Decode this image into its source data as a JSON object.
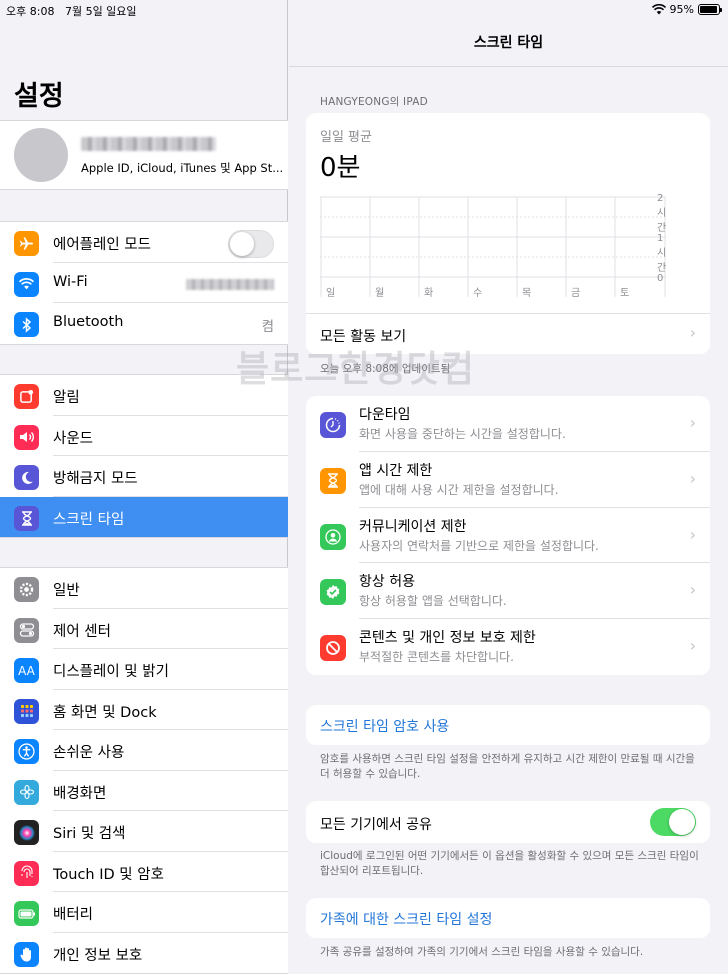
{
  "status": {
    "time": "오후 8:08",
    "date": "7월 5일 일요일",
    "battery": "95%",
    "battery_level": 0.95
  },
  "sidebar": {
    "title": "설정",
    "account_sub": "Apple ID, iCloud, iTunes 및 App St...",
    "group1": [
      {
        "label": "에어플레인 모드",
        "icon": "airplane-icon",
        "color": "#ff9500"
      },
      {
        "label": "Wi-Fi",
        "icon": "wifi-icon",
        "color": "#0a84ff"
      },
      {
        "label": "Bluetooth",
        "icon": "bluetooth-icon",
        "color": "#0a84ff",
        "value": "켬"
      }
    ],
    "group2": [
      {
        "label": "알림",
        "icon": "notifications-icon",
        "color": "#ff3b30"
      },
      {
        "label": "사운드",
        "icon": "sound-icon",
        "color": "#ff2d55"
      },
      {
        "label": "방해금지 모드",
        "icon": "moon-icon",
        "color": "#5856d6"
      },
      {
        "label": "스크린 타임",
        "icon": "hourglass-icon",
        "color": "#5856d6",
        "selected": true
      }
    ],
    "group3": [
      {
        "label": "일반",
        "icon": "gear-icon",
        "color": "#8e8e93"
      },
      {
        "label": "제어 센터",
        "icon": "toggles-icon",
        "color": "#8e8e93"
      },
      {
        "label": "디스플레이 및 밝기",
        "icon": "display-icon",
        "color": "#0a84ff"
      },
      {
        "label": "홈 화면 및 Dock",
        "icon": "home-grid-icon",
        "color": "#2f53d8"
      },
      {
        "label": "손쉬운 사용",
        "icon": "accessibility-icon",
        "color": "#0a84ff"
      },
      {
        "label": "배경화면",
        "icon": "flower-icon",
        "color": "#34aadc"
      },
      {
        "label": "Siri 및 검색",
        "icon": "siri-icon",
        "color": "#222"
      },
      {
        "label": "Touch ID 및 암호",
        "icon": "fingerprint-icon",
        "color": "#ff2d55"
      },
      {
        "label": "배터리",
        "icon": "battery-icon",
        "color": "#34c759"
      },
      {
        "label": "개인 정보 보호",
        "icon": "hand-icon",
        "color": "#0a84ff"
      }
    ]
  },
  "main": {
    "title": "스크린 타임",
    "device_label": "HANGYEONG의 IPAD",
    "daily_avg_label": "일일 평균",
    "daily_avg_value": "0분",
    "chart_y_labels": [
      "2시간",
      "1시간",
      "0"
    ],
    "chart_days": [
      "일",
      "월",
      "화",
      "수",
      "목",
      "금",
      "토"
    ],
    "see_all": "모든 활동 보기",
    "updated": "오늘 오후 8:08에 업데이트됨",
    "watermark": "블로그한경닷컴",
    "features": [
      {
        "title": "다운타임",
        "sub": "화면 사용을 중단하는 시간을 설정합니다.",
        "icon": "downtime-icon",
        "color": "#5856d6"
      },
      {
        "title": "앱 시간 제한",
        "sub": "앱에 대해 사용 시간 제한을 설정합니다.",
        "icon": "hourglass-icon",
        "color": "#ff9500"
      },
      {
        "title": "커뮤니케이션 제한",
        "sub": "사용자의 연락처를 기반으로 제한을 설정합니다.",
        "icon": "contact-icon",
        "color": "#34c759"
      },
      {
        "title": "항상 허용",
        "sub": "항상 허용할 앱을 선택합니다.",
        "icon": "check-shield-icon",
        "color": "#34c759"
      },
      {
        "title": "콘텐츠 및 개인 정보 보호 제한",
        "sub": "부적절한 콘텐츠를 차단합니다.",
        "icon": "restrict-icon",
        "color": "#ff3b30"
      }
    ],
    "passcode_link": "스크린 타임 암호 사용",
    "passcode_note": "암호를 사용하면 스크린 타임 설정을 안전하게 유지하고 시간 제한이 만료될 때 시간을 더 허용할 수 있습니다.",
    "share_label": "모든 기기에서 공유",
    "share_on": true,
    "share_note": "iCloud에 로그인된 어떤 기기에서든 이 옵션을 활성화할 수 있으며 모든 스크린 타임이 합산되어 리포트됩니다.",
    "family_link": "가족에 대한 스크린 타임 설정",
    "family_note": "가족 공유를 설정하여 가족의 기기에서 스크린 타임을 사용할 수 있습니다."
  }
}
